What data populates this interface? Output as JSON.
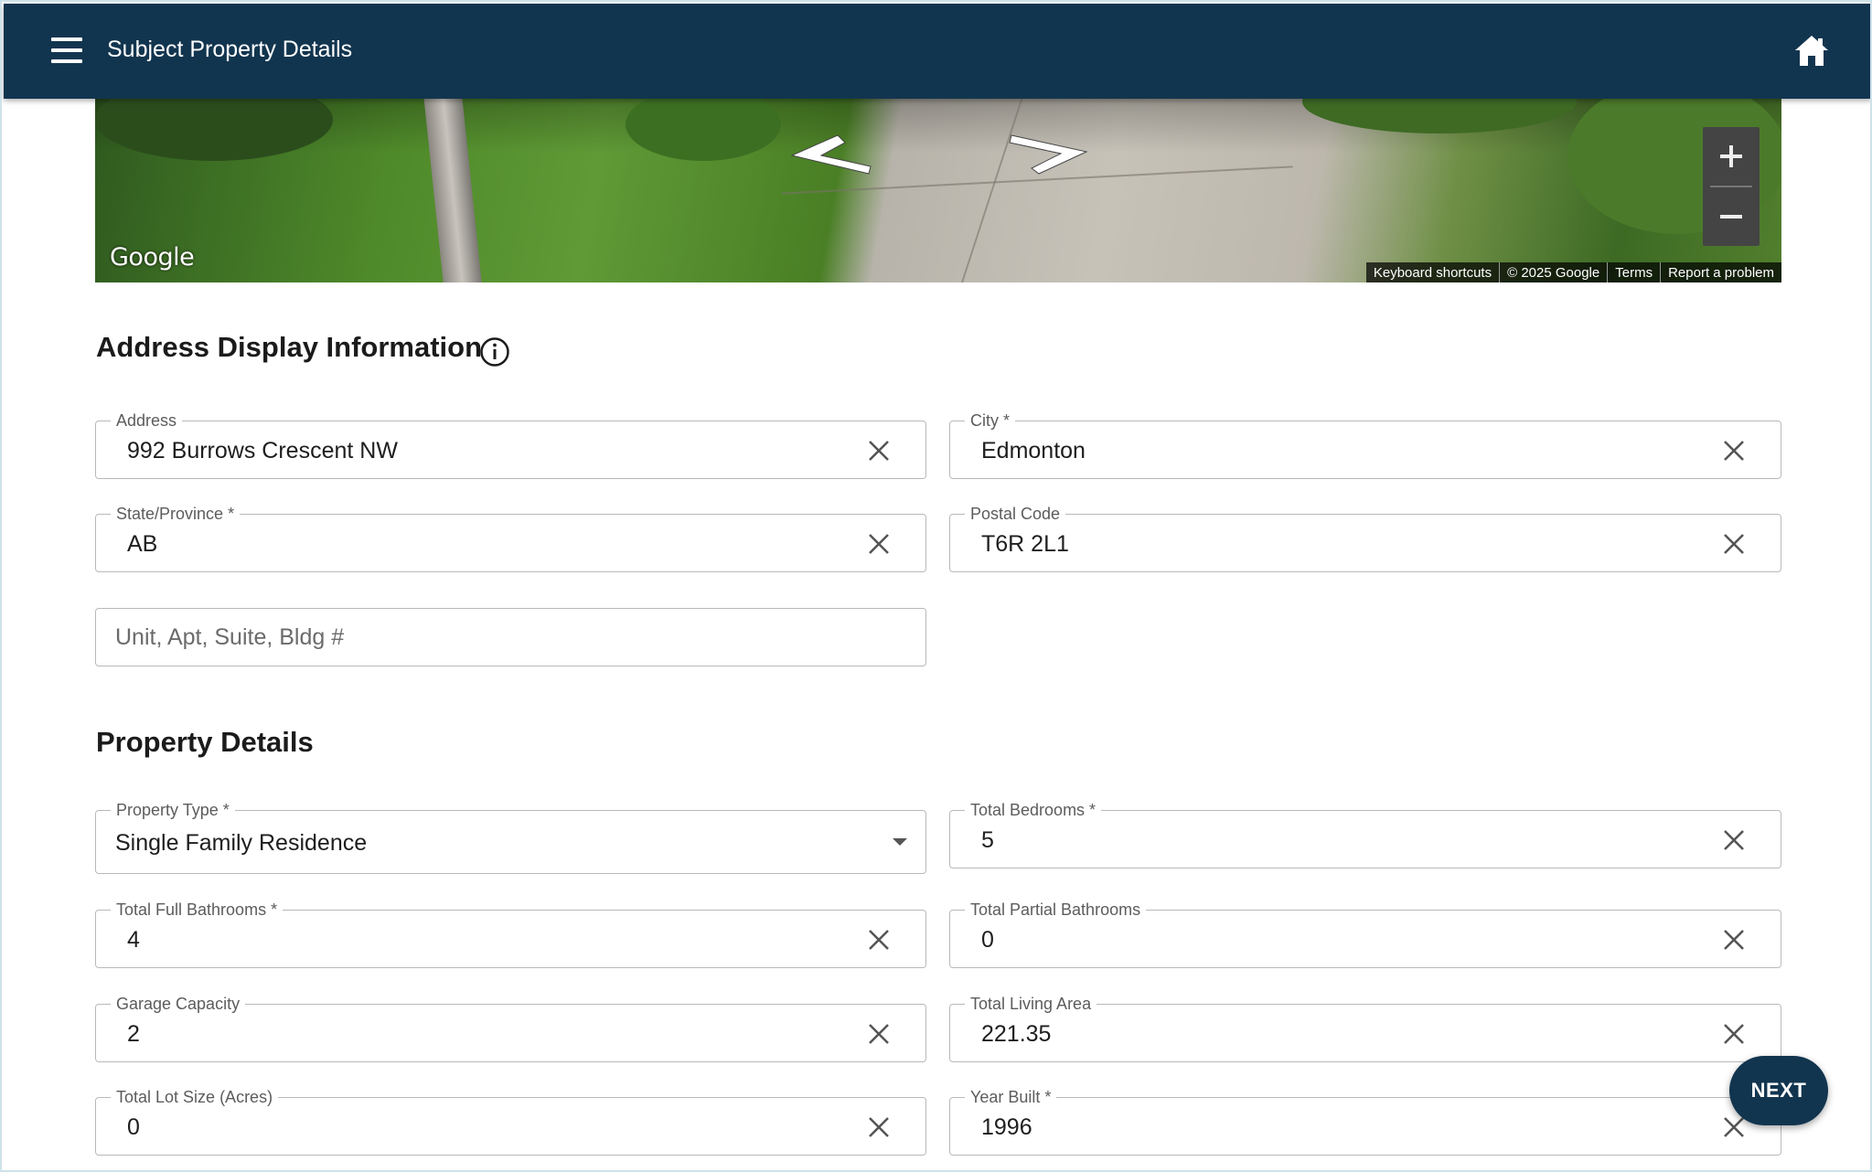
{
  "appbar": {
    "title": "Subject Property Details"
  },
  "streetview": {
    "logo": "Google",
    "attribution": [
      "Keyboard shortcuts",
      "© 2025 Google",
      "Terms",
      "Report a problem"
    ]
  },
  "address_section": {
    "title": "Address Display Information",
    "fields": {
      "address": {
        "label": "Address",
        "value": "992 Burrows Crescent NW"
      },
      "city": {
        "label": "City *",
        "value": "Edmonton"
      },
      "state": {
        "label": "State/Province *",
        "value": "AB"
      },
      "postal": {
        "label": "Postal Code",
        "value": "T6R 2L1"
      },
      "unit": {
        "placeholder": "Unit, Apt, Suite, Bldg #"
      }
    }
  },
  "property_section": {
    "title": "Property Details",
    "fields": {
      "property_type": {
        "label": "Property Type *",
        "value": "Single Family Residence"
      },
      "bedrooms": {
        "label": "Total Bedrooms *",
        "value": "5"
      },
      "full_baths": {
        "label": "Total Full Bathrooms *",
        "value": "4"
      },
      "partial_baths": {
        "label": "Total Partial Bathrooms",
        "value": "0"
      },
      "garage": {
        "label": "Garage Capacity",
        "value": "2"
      },
      "living_area": {
        "label": "Total Living Area",
        "value": "221.35"
      },
      "lot_size": {
        "label": "Total Lot Size (Acres)",
        "value": "0"
      },
      "year_built": {
        "label": "Year Built *",
        "value": "1996"
      }
    }
  },
  "actions": {
    "next": "NEXT"
  },
  "icons": [
    "menu-icon",
    "home-icon",
    "info-icon",
    "close-icon",
    "chevron-down-icon",
    "plus-icon",
    "minus-icon",
    "arrow-left-icon",
    "arrow-right-icon"
  ],
  "colors": {
    "appbar": "#12354f",
    "accent": "#12354f"
  }
}
